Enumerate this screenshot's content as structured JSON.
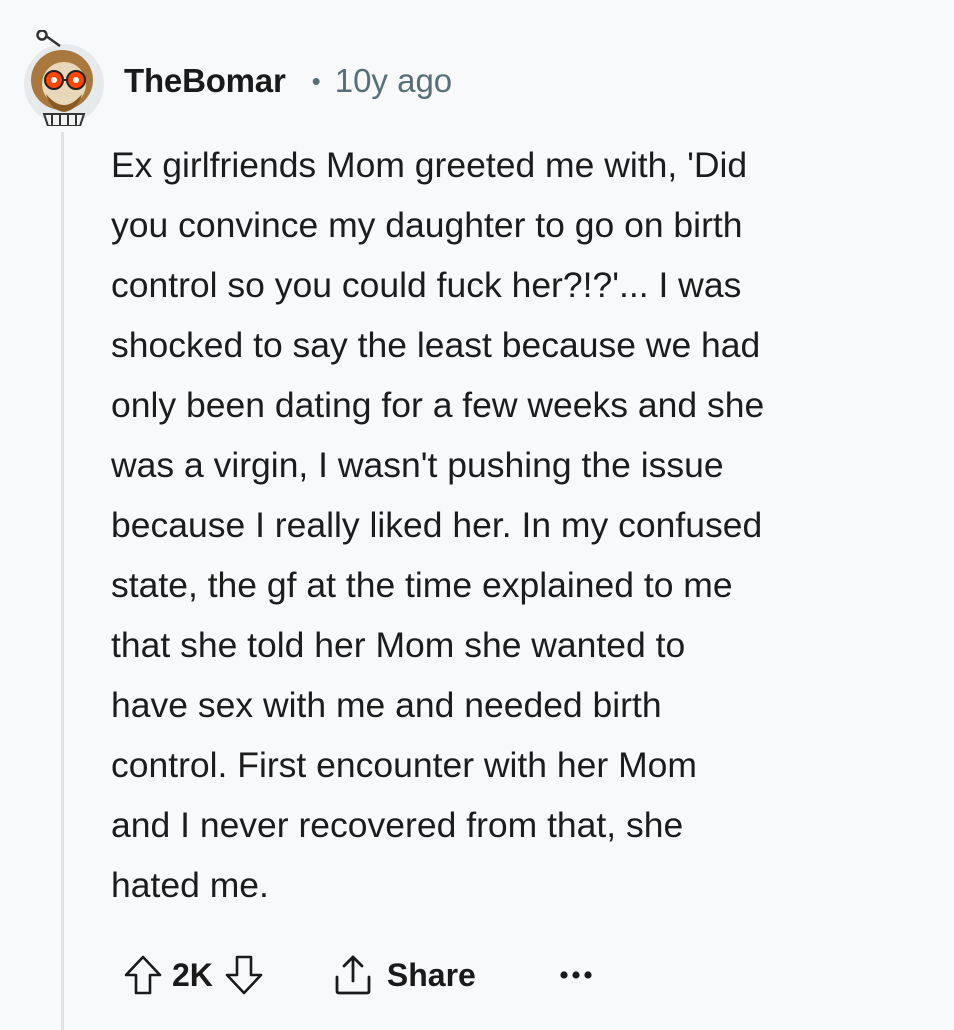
{
  "comment": {
    "author": "TheBomar",
    "separator": "•",
    "timestamp": "10y ago",
    "body_lines": [
      "Ex girlfriends Mom greeted me with, 'Did",
      "you convince my daughter to go on birth",
      "control so you could fuck her?!?'... I was",
      "shocked to say the least because we had",
      "only been dating for a few weeks and she",
      "was a virgin, I wasn't pushing the issue",
      "because I really liked her. In my confused",
      "state, the gf at the time explained to me",
      "that she told her Mom she wanted to",
      "have sex with me and needed birth",
      "control. First encounter with her Mom",
      "and I never recovered from that, she",
      "hated me."
    ]
  },
  "actions": {
    "score": "2K",
    "share_label": "Share"
  },
  "icons": {
    "upvote": "arrow-up-outline-icon",
    "downvote": "arrow-down-outline-icon",
    "share": "share-icon",
    "more": "ellipsis-icon"
  },
  "colors": {
    "background": "#f8f9fa",
    "meta": "#576f76",
    "text": "#1c1c1c",
    "thread_line": "#dfe3e6"
  }
}
